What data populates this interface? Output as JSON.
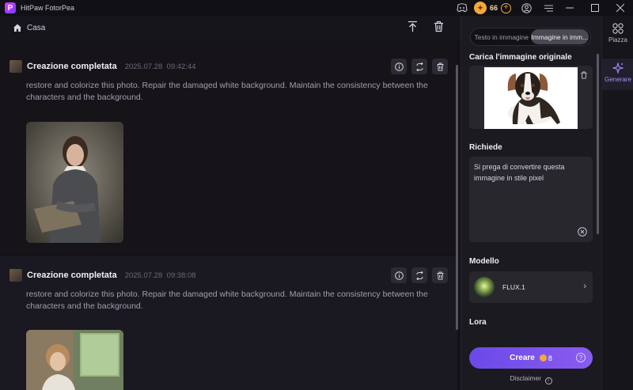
{
  "app": {
    "title": "HitPaw FotorPea",
    "logo_letter": "P",
    "credits": "66",
    "accent": "#7b55ec"
  },
  "toolbar": {
    "breadcrumb": "Casa"
  },
  "cards": [
    {
      "title": "Creazione completata",
      "date": "2025.07.28",
      "time": "09:42:44",
      "prompt": "restore and colorize this photo. Repair the damaged white background. Maintain the consistency between the characters and the background."
    },
    {
      "title": "Creazione completata",
      "date": "2025.07.28",
      "time": "09:38:08",
      "prompt": "restore and colorize this photo. Repair the damaged white background. Maintain the consistency between the characters and the background."
    }
  ],
  "panel": {
    "tabs": [
      "Testo in immagine",
      "Immagine in imm..."
    ],
    "active_tab": 1,
    "upload_label": "Carica l'immagine originale",
    "prompt_label": "Richiede",
    "prompt_value": "Si prega di convertire questa immagine in stile pixel",
    "model_label": "Modello",
    "model_name": "FLUX.1",
    "lora_label": "Lora",
    "create_label": "Creare",
    "create_cost": "8",
    "disclaimer": "Disclaimer"
  },
  "nav": {
    "items": [
      {
        "label": "Piazza",
        "icon": "grid-icon"
      },
      {
        "label": "Generare",
        "icon": "sparkle-icon"
      }
    ]
  }
}
